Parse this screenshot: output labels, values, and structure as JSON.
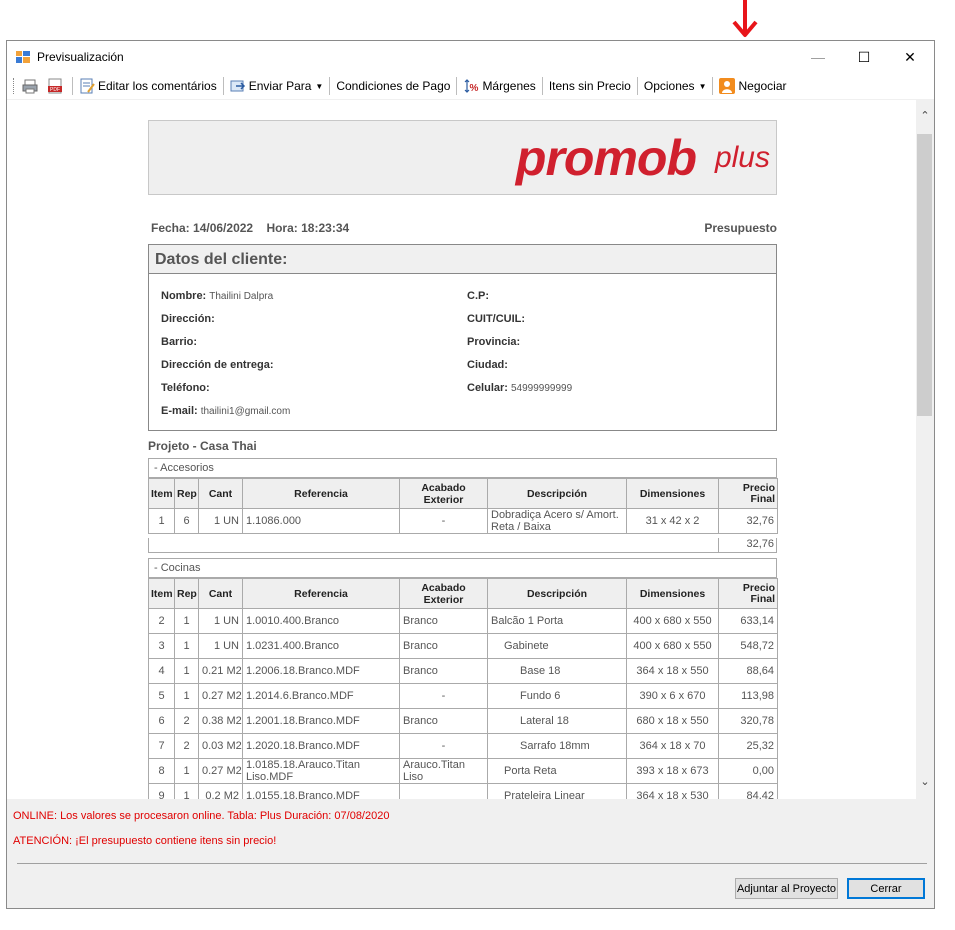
{
  "window": {
    "title": "Previsualización"
  },
  "toolbar": {
    "edit_comments": "Editar los comentários",
    "send_to": "Enviar Para",
    "payment_conditions": "Condiciones de Pago",
    "margins": "Márgenes",
    "items_no_price": "Itens sin Precio",
    "options": "Opciones",
    "negotiate": "Negociar"
  },
  "logo": {
    "main": "promob",
    "sub": "plus"
  },
  "header": {
    "fecha_label": "Fecha:",
    "fecha": "14/06/2022",
    "hora_label": "Hora:",
    "hora": "18:23:34",
    "doc_type": "Presupuesto"
  },
  "client": {
    "title": "Datos del cliente:",
    "nombre_label": "Nombre:",
    "nombre": "Thailini Dalpra",
    "cp_label": "C.P:",
    "direccion_label": "Dirección:",
    "cuit_label": "CUIT/CUIL:",
    "barrio_label": "Barrio:",
    "provincia_label": "Provincia:",
    "entrega_label": "Dirección de entrega:",
    "ciudad_label": "Ciudad:",
    "telefono_label": "Teléfono:",
    "celular_label": "Celular:",
    "celular": "54999999999",
    "email_label": "E-mail:",
    "email": "thailini1@gmail.com"
  },
  "project": {
    "title": "Projeto - Casa Thai"
  },
  "columns": [
    "Item",
    "Rep",
    "Cant",
    "Referencia",
    "Acabado Exterior",
    "Descripción",
    "Dimensiones",
    "Precio Final"
  ],
  "sections": [
    {
      "title": "- Accesorios",
      "rows": [
        [
          "1",
          "6",
          "1 UN",
          "1.1086.000",
          "-",
          "Dobradiça Acero s/ Amort. Reta / Baixa",
          "31 x 42 x 2",
          "32,76"
        ]
      ],
      "total": "32,76"
    },
    {
      "title": "- Cocinas",
      "rows": [
        [
          "2",
          "1",
          "1 UN",
          "1.0010.400.Branco",
          "Branco",
          "Balcão 1 Porta",
          "400 x 680 x 550",
          "633,14"
        ],
        [
          "3",
          "1",
          "1 UN",
          "1.0231.400.Branco",
          "Branco",
          "Gabinete",
          "400 x 680 x 550",
          "548,72"
        ],
        [
          "4",
          "1",
          "0.21 M2",
          "1.2006.18.Branco.MDF",
          "Branco",
          "Base 18",
          "364 x 18 x 550",
          "88,64"
        ],
        [
          "5",
          "1",
          "0.27 M2",
          "1.2014.6.Branco.MDF",
          "-",
          "Fundo 6",
          "390 x 6 x 670",
          "113,98"
        ],
        [
          "6",
          "2",
          "0.38 M2",
          "1.2001.18.Branco.MDF",
          "Branco",
          "Lateral 18",
          "680 x 18 x 550",
          "320,78"
        ],
        [
          "7",
          "2",
          "0.03 M2",
          "1.2020.18.Branco.MDF",
          "-",
          "Sarrafo 18mm",
          "364 x 18 x 70",
          "25,32"
        ],
        [
          "8",
          "1",
          "0.27 M2",
          "1.0185.18.Arauco.Titan Liso.MDF",
          "Arauco.Titan Liso",
          "Porta Reta",
          "393 x 18 x 673",
          "0,00"
        ],
        [
          "9",
          "1",
          "0.2 M2",
          "1.0155.18.Branco.MDF",
          "",
          "Prateleira Linear",
          "364 x 18 x 530",
          "84,42"
        ]
      ]
    }
  ],
  "status": {
    "online": "ONLINE: Los valores se procesaron online. Tabla: Plus Duración: 07/08/2020",
    "warning": "ATENCIÓN: ¡El presupuesto contiene itens sin precio!"
  },
  "buttons": {
    "attach": "Adjuntar al Proyecto",
    "close": "Cerrar"
  },
  "colors": {
    "brand": "#d0202e",
    "status": "#e00000",
    "accent": "#0078d7"
  }
}
